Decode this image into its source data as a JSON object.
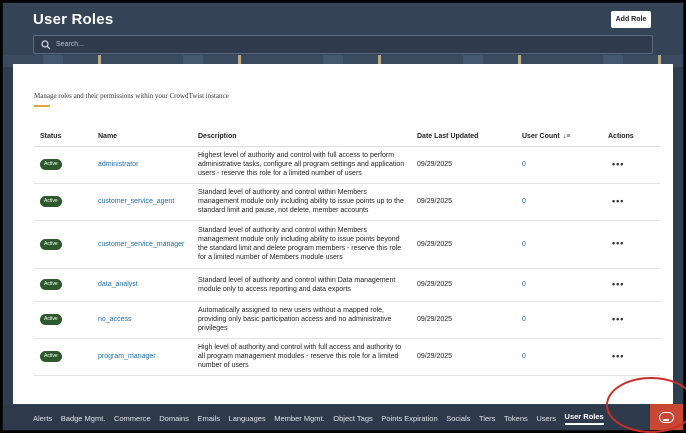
{
  "header": {
    "title": "User Roles",
    "add_role_label": "Add Role",
    "search_placeholder": "Search..."
  },
  "main": {
    "subtitle": "Manage roles and their permissions within your CrowdTwist instance",
    "columns": {
      "status": "Status",
      "name": "Name",
      "description": "Description",
      "date": "Date Last Updated",
      "count": "User Count",
      "actions": "Actions"
    },
    "rows": [
      {
        "status": "Active",
        "name": "administrator",
        "description": "Highest level of authority and control with full access to perform administrative tasks, configure all program settings and application users - reserve this role for a limited number of users",
        "date": "09/29/2025",
        "count": "0"
      },
      {
        "status": "Active",
        "name": "customer_service_agent",
        "description": "Standard level of authority and control within Members management module only including ability to issue points up to the standard limit and pause, not delete, member accounts",
        "date": "09/29/2025",
        "count": "0"
      },
      {
        "status": "Active",
        "name": "customer_service_manager",
        "description": "Standard level of authority and control within Members management module only including ability to issue points beyond the standard limit and delete program members - reserve this role for a limited number of Members module users",
        "date": "09/29/2025",
        "count": "0"
      },
      {
        "status": "Active",
        "name": "data_analyst",
        "description": "Standard level of authority and control within Data management module only to access reporting and data exports",
        "date": "09/29/2025",
        "count": "0"
      },
      {
        "status": "Active",
        "name": "no_access",
        "description": "Automatically assigned to new users without a mapped role, providing only basic participation access and no administrative privileges",
        "date": "09/29/2025",
        "count": "0"
      },
      {
        "status": "Active",
        "name": "program_manager",
        "description": "High level of authority and control with full access and authority to all program management modules - reserve this role for a limited number of users",
        "date": "09/29/2025",
        "count": "0"
      }
    ]
  },
  "nav": {
    "items": [
      "Alerts",
      "Badge Mgmt.",
      "Commerce",
      "Domains",
      "Emails",
      "Languages",
      "Member Mgmt.",
      "Object Tags",
      "Points Expiration",
      "Socials",
      "Tiers",
      "Tokens",
      "Users",
      "User Roles"
    ],
    "active": "User Roles"
  },
  "colors": {
    "header_bg": "#354357",
    "badge_green": "#2d5a2d",
    "link_blue": "#216fa8",
    "accent_gold": "#e0a63c",
    "chat_red": "#c74634"
  }
}
